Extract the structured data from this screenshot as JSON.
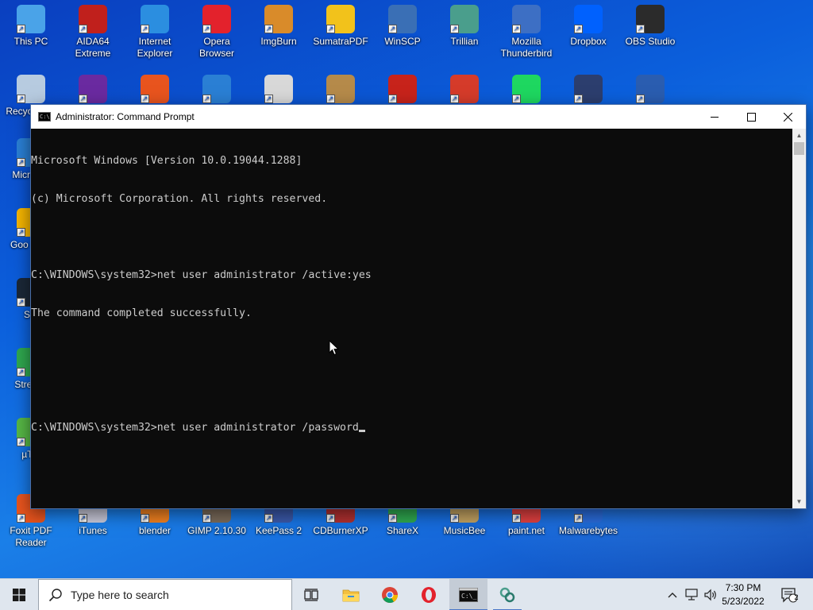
{
  "desktop": {
    "icons": [
      {
        "label": "This PC",
        "color": "#4aa3e8"
      },
      {
        "label": "AIDA64 Extreme",
        "color": "#c0201c"
      },
      {
        "label": "Internet Explorer",
        "color": "#2b8ee0"
      },
      {
        "label": "Opera Browser",
        "color": "#e3222c"
      },
      {
        "label": "ImgBurn",
        "color": "#d98b2a"
      },
      {
        "label": "SumatraPDF",
        "color": "#f2c21b"
      },
      {
        "label": "WinSCP",
        "color": "#3a6fb5"
      },
      {
        "label": "Trillian",
        "color": "#4a9e8c"
      },
      {
        "label": "Mozilla Thunderbird",
        "color": "#3d6fc4"
      },
      {
        "label": "Dropbox",
        "color": "#0061fe"
      },
      {
        "label": "OBS Studio",
        "color": "#2b2b2b"
      }
    ],
    "row2_icons": [
      {
        "label": "Recycle Bin",
        "color": "#b7cbe0"
      },
      {
        "label": "",
        "color": "#6a2aa0"
      },
      {
        "label": "",
        "color": "#e8541e"
      },
      {
        "label": "",
        "color": "#2a7fd4"
      },
      {
        "label": "",
        "color": "#d8d8d8"
      },
      {
        "label": "",
        "color": "#b58a4a"
      },
      {
        "label": "",
        "color": "#c7231b"
      },
      {
        "label": "",
        "color": "#d53b2a"
      },
      {
        "label": "",
        "color": "#1ed760"
      },
      {
        "label": "",
        "color": "#2c3e6e"
      },
      {
        "label": "",
        "color": "#2a5db0"
      }
    ],
    "left_partial_labels": [
      "Recyc",
      "Micro Ed",
      "Goo Chro",
      "Ste",
      "Strea O",
      "µTor"
    ],
    "bottom_icons": [
      {
        "label": "Foxit PDF Reader",
        "color": "#e8541e"
      },
      {
        "label": "iTunes",
        "color": "#c8c8d8"
      },
      {
        "label": "blender",
        "color": "#f08020"
      },
      {
        "label": "GIMP 2.10.30",
        "color": "#7a6a5a"
      },
      {
        "label": "KeePass 2",
        "color": "#3a58a8"
      },
      {
        "label": "CDBurnerXP",
        "color": "#b03030"
      },
      {
        "label": "ShareX",
        "color": "#2fa84f"
      },
      {
        "label": "MusicBee",
        "color": "#c0a060"
      },
      {
        "label": "paint.net",
        "color": "#e04040"
      },
      {
        "label": "Malwarebytes",
        "color": "#2a6ad8"
      }
    ]
  },
  "cmd": {
    "title": "Administrator: Command Prompt",
    "lines": [
      "Microsoft Windows [Version 10.0.19044.1288]",
      "(c) Microsoft Corporation. All rights reserved.",
      "",
      "C:\\WINDOWS\\system32>net user administrator /active:yes",
      "The command completed successfully.",
      "",
      "",
      "C:\\WINDOWS\\system32>net user administrator /password"
    ],
    "buttons": {
      "minimize": "—",
      "maximize": "☐",
      "close": "✕"
    }
  },
  "taskbar": {
    "search_placeholder": "Type here to search",
    "time": "7:30 PM",
    "date": "5/23/2022",
    "notification_count": "2"
  }
}
